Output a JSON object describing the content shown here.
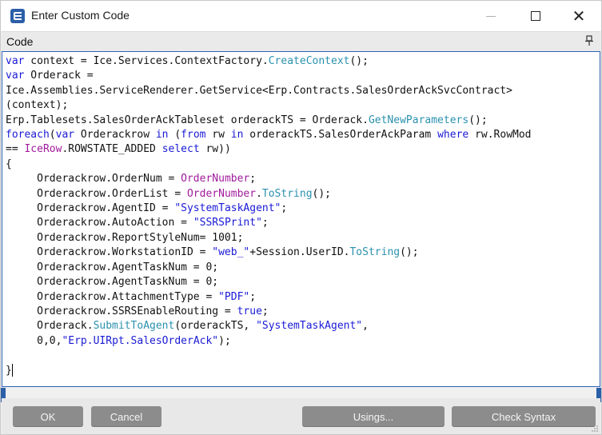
{
  "window": {
    "title": "Enter Custom Code",
    "controls": {
      "minimize": "—",
      "maximize": "☐",
      "close": "✕"
    }
  },
  "panel": {
    "label": "Code"
  },
  "code_lines": [
    "var context = Ice.Services.ContextFactory.CreateContext();",
    "var Orderack =",
    "Ice.Assemblies.ServiceRenderer.GetService<Erp.Contracts.SalesOrderAckSvcContract>",
    "(context);",
    "Erp.Tablesets.SalesOrderAckTableset orderackTS = Orderack.GetNewParameters();",
    "foreach(var Orderackrow in (from rw in orderackTS.SalesOrderAckParam where rw.RowMod",
    "== IceRow.ROWSTATE_ADDED select rw))",
    "{",
    "     Orderackrow.OrderNum = OrderNumber;",
    "     Orderackrow.OrderList = OrderNumber.ToString();",
    "     Orderackrow.AgentID = \"SystemTaskAgent\";",
    "     Orderackrow.AutoAction = \"SSRSPrint\";",
    "     Orderackrow.ReportStyleNum= 1001;",
    "     Orderackrow.WorkstationID = \"web_\"+Session.UserID.ToString();",
    "     Orderackrow.AgentTaskNum = 0;",
    "     Orderackrow.AgentTaskNum = 0;",
    "     Orderackrow.AttachmentType = \"PDF\";",
    "     Orderackrow.SSRSEnableRouting = true;",
    "     Orderack.SubmitToAgent(orderackTS, \"SystemTaskAgent\",",
    "     0,0,\"Erp.UIRpt.SalesOrderAck\");",
    "",
    "}"
  ],
  "buttons": {
    "ok": "OK",
    "cancel": "Cancel",
    "usings": "Usings...",
    "check_syntax": "Check Syntax"
  },
  "colors": {
    "keyword": "#1a1ad6",
    "method": "#2b91af",
    "string": "#1a1ad6",
    "property_value": "#a11a9c",
    "button_bg": "#8c8c8c",
    "accent": "#2b5fa8"
  }
}
